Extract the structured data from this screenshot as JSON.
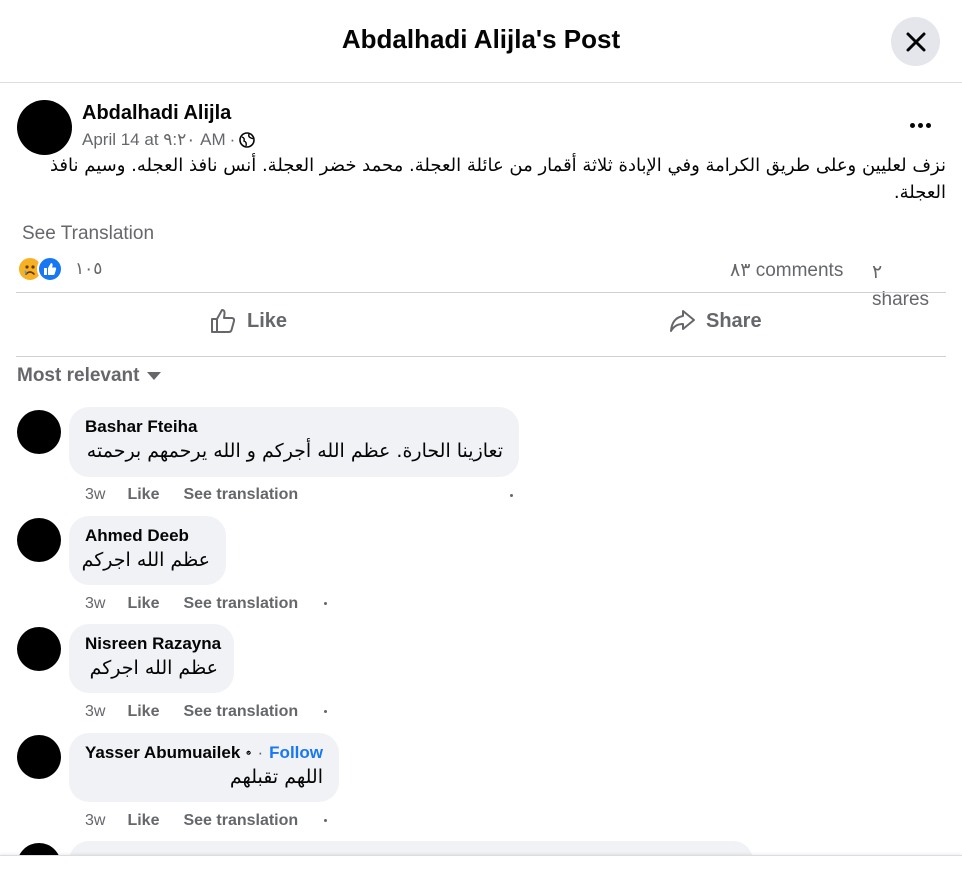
{
  "header": {
    "title": "Abdalhadi Alijla's Post",
    "close_icon": "close-icon"
  },
  "post": {
    "author": "Abdalhadi Alijla",
    "date": "April 14 at ٩:٢٠ AM",
    "separator": "·",
    "audience_icon": "globe-icon",
    "more_icon": "more-horizontal-icon",
    "text": "نزف لعليين وعلى طريق الكرامة وفي الإبادة ثلاثة أقمار من عائلة العجلة. محمد خضر العجلة. أنس نافذ العجله. وسيم نافذ العجلة.",
    "see_translation": "See Translation",
    "reaction_icons": [
      "sad-reaction-icon",
      "like-reaction-icon"
    ],
    "reaction_count": "١٠٥",
    "comments_label": "٨٣ comments",
    "shares_count": "٢",
    "shares_label": "shares",
    "colors": {
      "accent": "#1877f2",
      "secondary_text": "#65676b",
      "bubble": "#f0f2f5"
    }
  },
  "actions": {
    "like_label": "Like",
    "like_icon": "thumbs-up-icon",
    "share_label": "Share",
    "share_icon": "share-arrow-icon"
  },
  "comments_section": {
    "sort_label": "Most relevant",
    "sort_icon": "caret-down-icon",
    "comments": [
      {
        "name": "Bashar Fteiha",
        "text": "تعازينا الحارة. عظم الله أجركم و الله يرحمهم برحمته",
        "time": "3w",
        "like": "Like",
        "see_translation": "See translation"
      },
      {
        "name": "Ahmed Deeb",
        "text": "عظم الله اجركم",
        "time": "3w",
        "like": "Like",
        "see_translation": "See translation"
      },
      {
        "name": "Nisreen Razayna",
        "text": "عظم الله اجركم",
        "time": "3w",
        "like": "Like",
        "see_translation": "See translation"
      },
      {
        "name": "Yasser Abumuailek",
        "verified_icon": "verified-badge-icon",
        "separator": "·",
        "follow": "Follow",
        "text": "اللهم تقبلهم",
        "time": "3w",
        "like": "Like",
        "see_translation": "See translation"
      }
    ]
  }
}
